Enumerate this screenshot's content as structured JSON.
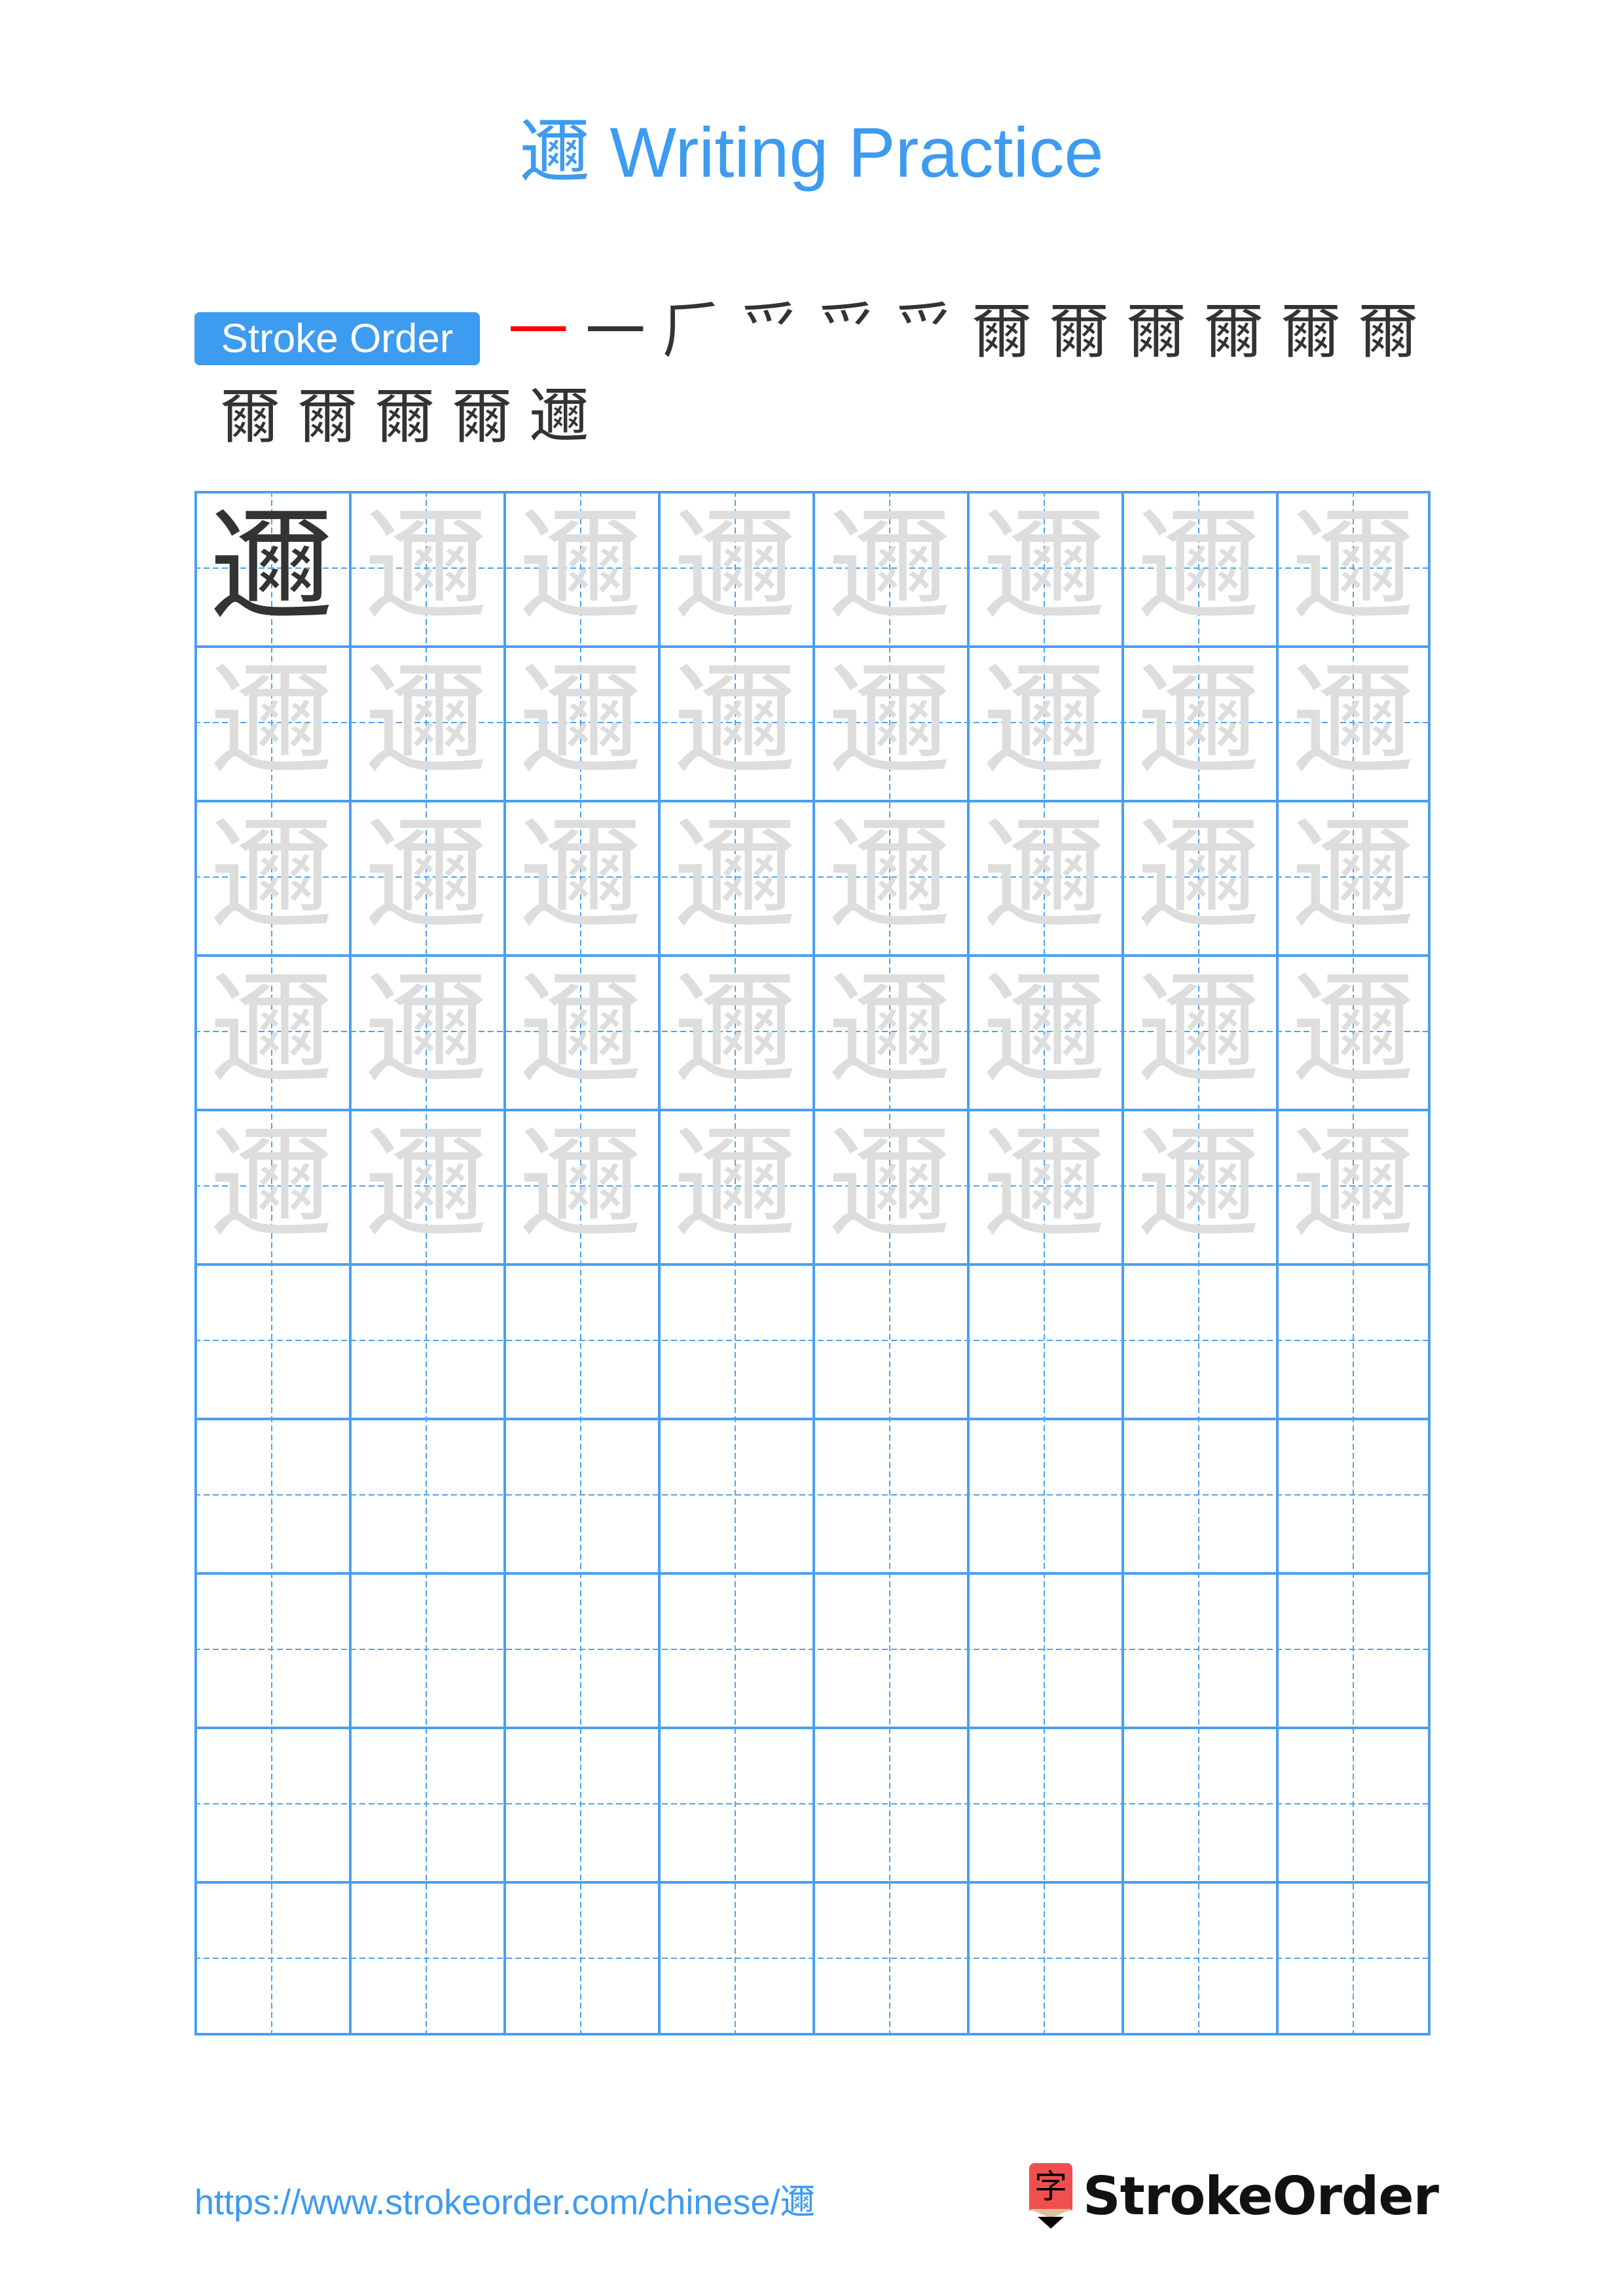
{
  "title": {
    "character": "邇",
    "suffix": " Writing Practice"
  },
  "stroke_order": {
    "label": "Stroke Order",
    "total_strokes": 17,
    "steps": [
      {
        "step": 1,
        "shown": "",
        "new": "一"
      },
      {
        "step": 2,
        "shown": "一",
        "new": "丿"
      },
      {
        "step": 3,
        "shown": "𠂆",
        "new": "丶"
      },
      {
        "step": 4,
        "shown": "爫",
        "new": "丨"
      },
      {
        "step": 5,
        "shown": "爫",
        "new": "丨"
      },
      {
        "step": 6,
        "shown": "爫",
        "new": "𠃌"
      },
      {
        "step": 7,
        "shown": "爾",
        "new": "丿"
      },
      {
        "step": 8,
        "shown": "爾",
        "new": "㐅"
      },
      {
        "step": 9,
        "shown": "爾",
        "new": "丿"
      },
      {
        "step": 10,
        "shown": "爾",
        "new": "㐅"
      },
      {
        "step": 11,
        "shown": "爾",
        "new": "丿"
      },
      {
        "step": 12,
        "shown": "爾",
        "new": "㐅"
      },
      {
        "step": 13,
        "shown": "爾",
        "new": "丿"
      },
      {
        "step": 14,
        "shown": "爾",
        "new": "㐅"
      },
      {
        "step": 15,
        "shown": "爾",
        "new": "丶"
      },
      {
        "step": 16,
        "shown": "爾",
        "new": "㇋"
      },
      {
        "step": 17,
        "shown": "邇",
        "new": "㇏"
      }
    ]
  },
  "grid": {
    "columns": 8,
    "rows": 10,
    "model_character": "邇",
    "trace_character": "邇",
    "trace_rows": 5,
    "blank_rows": 5
  },
  "colors": {
    "accent": "#3d9bf0",
    "grid_line": "#4a9ff0",
    "model": "#333333",
    "trace": "#dddddd",
    "stroke_highlight": "#ff0000"
  },
  "footer": {
    "url": "https://www.strokeorder.com/chinese/邇",
    "logo_icon_char": "字",
    "logo_text": "StrokeOrder"
  }
}
